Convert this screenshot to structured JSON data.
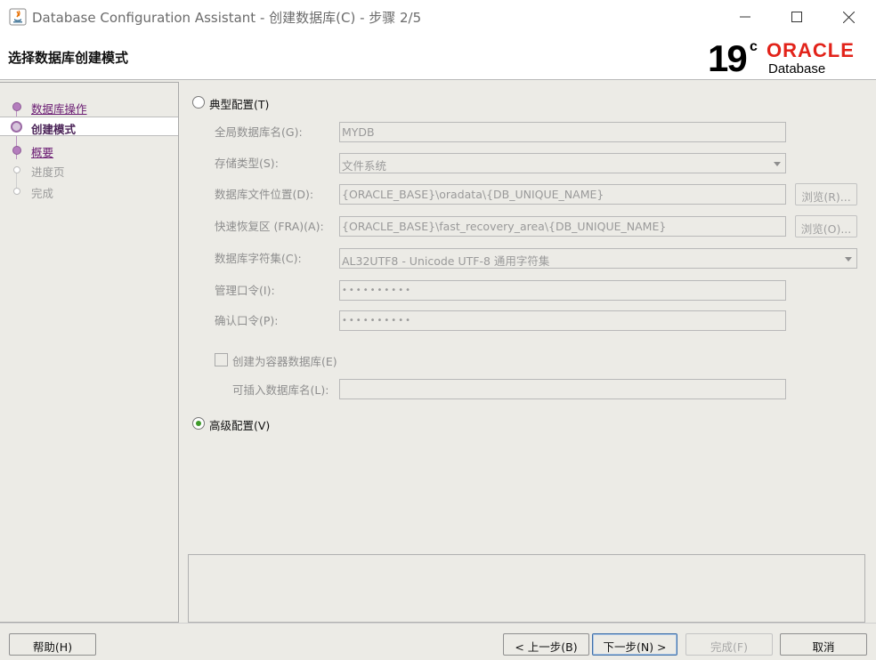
{
  "window": {
    "title": "Database Configuration Assistant - 创建数据库(C) - 步骤 2/5",
    "minimize_icon": "minimize-icon",
    "maximize_icon": "maximize-icon",
    "close_icon": "close-icon"
  },
  "header": {
    "title": "选择数据库创建模式",
    "logo": {
      "version": "19",
      "version_sup": "c",
      "brand": "ORACLE",
      "product": "Database"
    }
  },
  "steps": [
    {
      "label": "数据库操作",
      "state": "done"
    },
    {
      "label": "创建模式",
      "state": "current"
    },
    {
      "label": "概要",
      "state": "done"
    },
    {
      "label": "进度页",
      "state": "pending"
    },
    {
      "label": "完成",
      "state": "pending"
    }
  ],
  "typical": {
    "radio_label": "典型配置(T)",
    "selected": false,
    "global_db_name_label": "全局数据库名(G):",
    "global_db_name_value": "MYDB",
    "storage_type_label": "存储类型(S):",
    "storage_type_value": "文件系统",
    "db_file_location_label": "数据库文件位置(D):",
    "db_file_location_value": "{ORACLE_BASE}\\oradata\\{DB_UNIQUE_NAME}",
    "browse_r_label": "浏览(R)...",
    "fra_label": "快速恢复区 (FRA)(A):",
    "fra_value": "{ORACLE_BASE}\\fast_recovery_area\\{DB_UNIQUE_NAME}",
    "browse_o_label": "浏览(O)...",
    "charset_label": "数据库字符集(C):",
    "charset_value": "AL32UTF8 - Unicode UTF-8 通用字符集",
    "admin_pw_label": "管理口令(I):",
    "admin_pw_value": "••••••••••",
    "confirm_pw_label": "确认口令(P):",
    "confirm_pw_value": "••••••••••",
    "container_db_label": "创建为容器数据库(E)",
    "container_db_checked": false,
    "pdb_name_label": "可插入数据库名(L):",
    "pdb_name_value": ""
  },
  "advanced": {
    "radio_label": "高级配置(V)",
    "selected": true
  },
  "footer": {
    "help": "帮助(H)",
    "back": "< 上一步(B)",
    "next": "下一步(N) >",
    "finish": "完成(F)",
    "cancel": "取消"
  }
}
